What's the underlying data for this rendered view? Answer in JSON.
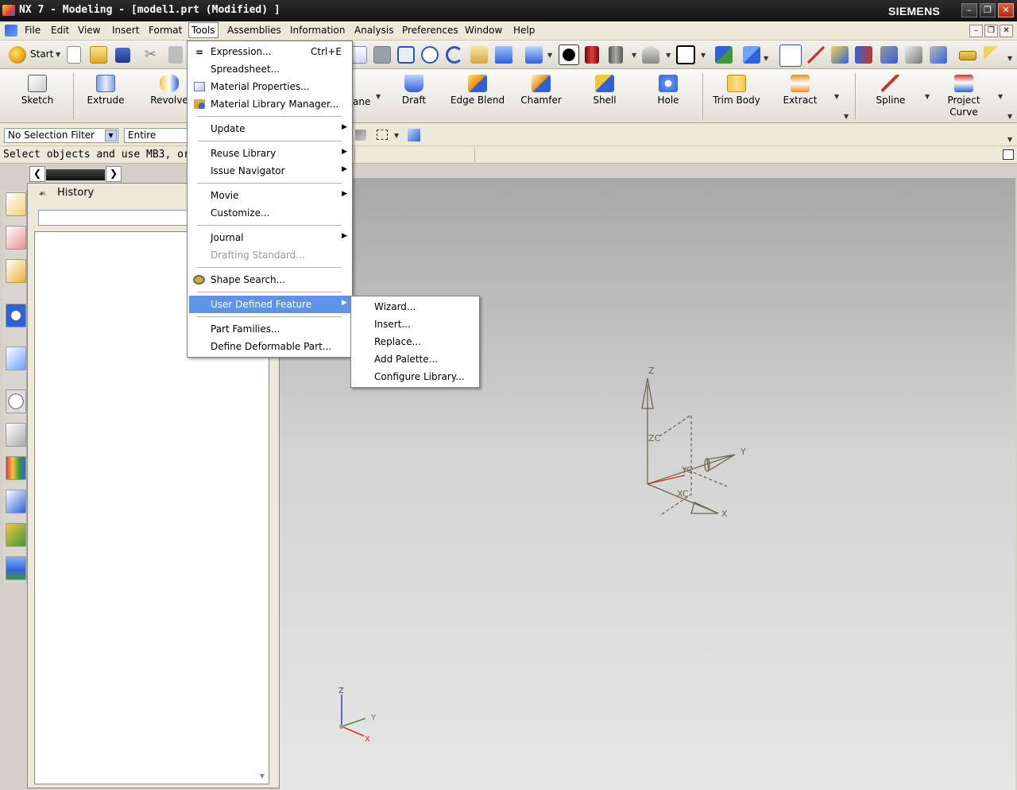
{
  "window": {
    "title": "NX 7 - Modeling - [model1.prt (Modified) ]",
    "brand": "SIEMENS"
  },
  "menubar": {
    "items": [
      "File",
      "Edit",
      "View",
      "Insert",
      "Format",
      "Tools",
      "Assemblies",
      "Information",
      "Analysis",
      "Preferences",
      "Window",
      "Help"
    ],
    "active": "Tools"
  },
  "toolbar": {
    "start_label": "Start"
  },
  "ribbon": {
    "buttons": [
      "Sketch",
      "Extrude",
      "Revolve",
      "ane",
      "Draft",
      "Edge Blend",
      "Chamfer",
      "Shell",
      "Hole",
      "Trim Body",
      "Extract",
      "Spline",
      "Project Curve"
    ]
  },
  "filterbar": {
    "selection_filter": "No Selection Filter",
    "scope": "Entire Assem"
  },
  "cue_line": "Select objects and use MB3, or dou",
  "navigator": {
    "title": "History"
  },
  "tools_menu": {
    "items": [
      {
        "label": "Expression...",
        "shortcut": "Ctrl+E"
      },
      {
        "label": "Spreadsheet..."
      },
      {
        "label": "Material Properties..."
      },
      {
        "label": "Material Library Manager..."
      },
      {
        "label": "Update"
      },
      {
        "label": "Reuse Library"
      },
      {
        "label": "Issue Navigator"
      },
      {
        "label": "Movie"
      },
      {
        "label": "Customize..."
      },
      {
        "label": "Journal"
      },
      {
        "label": "Drafting Standard..."
      },
      {
        "label": "Shape Search..."
      },
      {
        "label": "User Defined Feature"
      },
      {
        "label": "Part Families..."
      },
      {
        "label": "Define Deformable Part..."
      }
    ]
  },
  "udf_submenu": {
    "items": [
      "Wizard...",
      "Insert...",
      "Replace...",
      "Add Palette...",
      "Configure Library..."
    ]
  },
  "axes": {
    "wcs": {
      "z": "Z",
      "y": "Y",
      "x": "X",
      "zc": "ZC",
      "yc": "YC",
      "xc": "XC"
    },
    "triad": {
      "z": "Z",
      "y": "Y",
      "x": "X"
    }
  }
}
